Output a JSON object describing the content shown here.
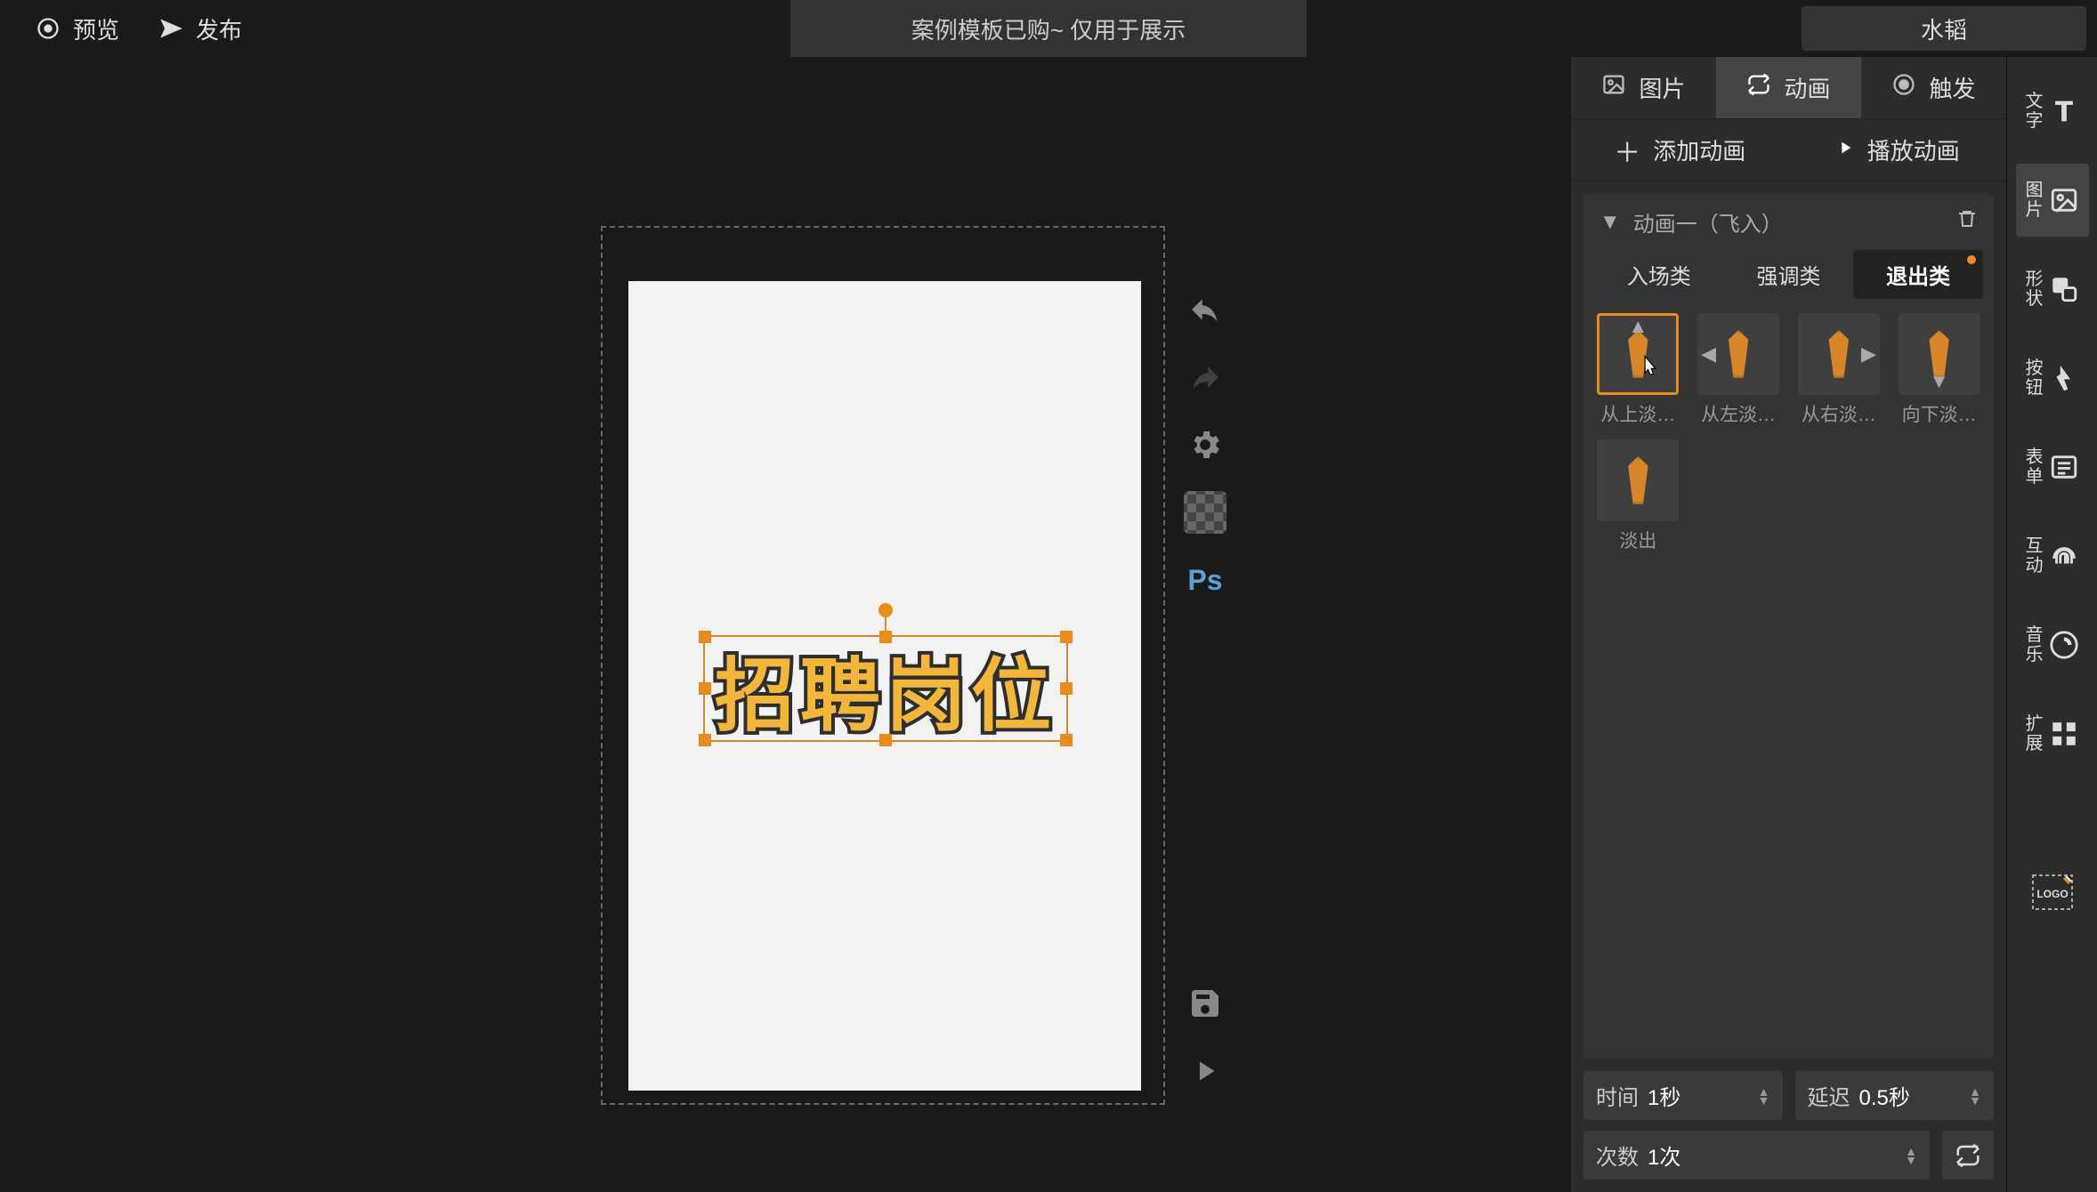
{
  "topbar": {
    "preview_label": "预览",
    "publish_label": "发布",
    "title": "案例模板已购~ 仅用于展示",
    "user": "水韬"
  },
  "canvas": {
    "selected_text": "招聘岗位"
  },
  "float_tools": {
    "undo_name": "undo-icon",
    "redo_name": "redo-icon",
    "settings_name": "gear-icon",
    "grid_name": "grid-toggle",
    "ps_label": "Ps",
    "save_name": "save-icon",
    "play_name": "play-icon"
  },
  "inspector": {
    "tabs": {
      "image": "图片",
      "animation": "动画",
      "trigger": "触发"
    },
    "actions": {
      "add": "添加动画",
      "play": "播放动画"
    },
    "animation_name": "动画一（飞入）",
    "categories": {
      "entry": "入场类",
      "emphasis": "强调类",
      "exit": "退出类"
    },
    "presets": [
      {
        "id": "fade-up",
        "label": "从上淡…",
        "dir": "up",
        "selected": true
      },
      {
        "id": "fade-left",
        "label": "从左淡…",
        "dir": "left",
        "selected": false
      },
      {
        "id": "fade-right",
        "label": "从右淡…",
        "dir": "right",
        "selected": false
      },
      {
        "id": "fade-down",
        "label": "向下淡…",
        "dir": "down",
        "selected": false
      },
      {
        "id": "fade-out",
        "label": "淡出",
        "dir": "",
        "selected": false
      }
    ],
    "steppers": {
      "time_label": "时间",
      "time_value": "1秒",
      "delay_label": "延迟",
      "delay_value": "0.5秒",
      "count_label": "次数",
      "count_value": "1次"
    }
  },
  "dock": [
    {
      "id": "text",
      "label": "文字",
      "icon": "text-icon"
    },
    {
      "id": "image",
      "label": "图片",
      "icon": "image-icon",
      "active": true
    },
    {
      "id": "shape",
      "label": "形状",
      "icon": "shape-icon"
    },
    {
      "id": "button",
      "label": "按钮",
      "icon": "button-icon"
    },
    {
      "id": "form",
      "label": "表单",
      "icon": "form-icon"
    },
    {
      "id": "interactive",
      "label": "互动",
      "icon": "fingerprint-icon"
    },
    {
      "id": "music",
      "label": "音乐",
      "icon": "music-icon"
    },
    {
      "id": "extend",
      "label": "扩展",
      "icon": "extend-icon"
    },
    {
      "id": "logo",
      "label": "",
      "icon": "logo-icon"
    }
  ]
}
